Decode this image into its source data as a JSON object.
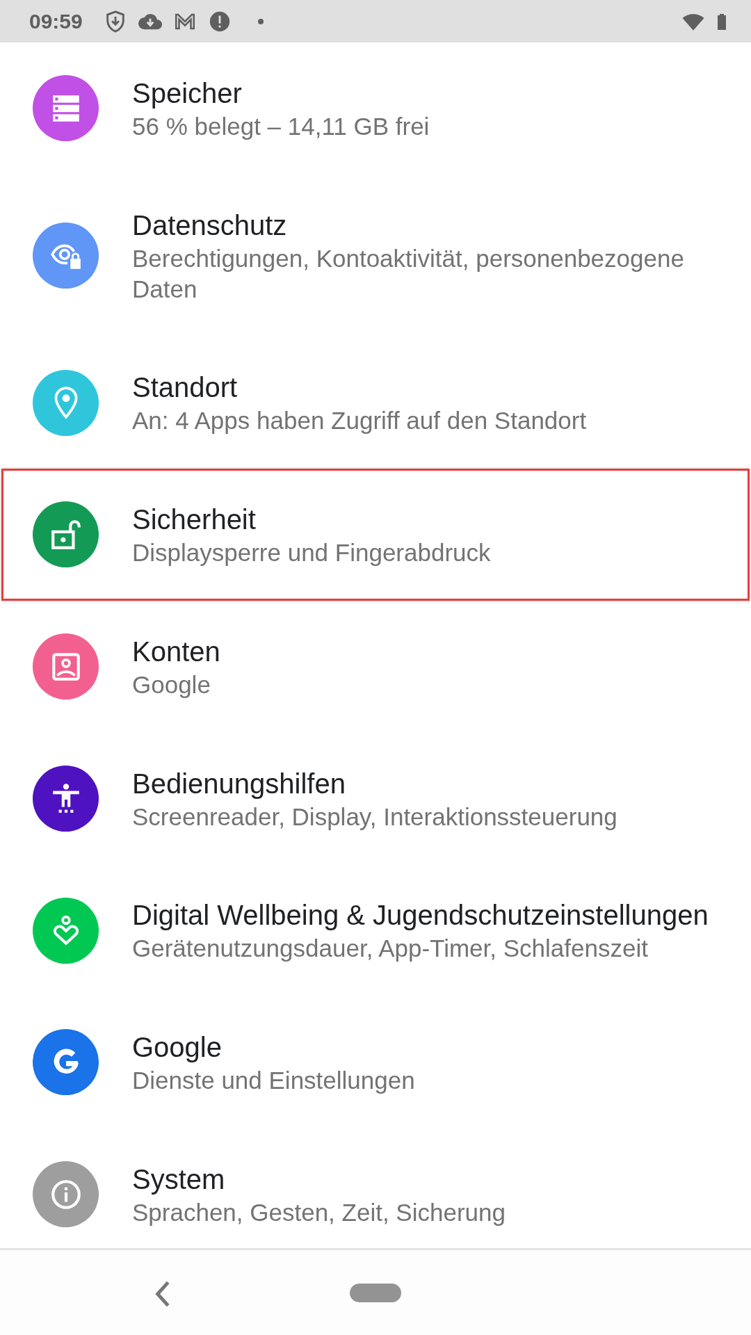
{
  "status_bar": {
    "time": "09:59"
  },
  "items": [
    {
      "title": "Speicher",
      "subtitle": "56 % belegt – 14,11 GB frei",
      "color": "#c150e6",
      "highlighted": false
    },
    {
      "title": "Datenschutz",
      "subtitle": "Berechtigungen, Kontoaktivität, personenbezogene Daten",
      "color": "#6096f5",
      "highlighted": false
    },
    {
      "title": "Standort",
      "subtitle": "An: 4 Apps haben Zugriff auf den Standort",
      "color": "#2fc6dc",
      "highlighted": false
    },
    {
      "title": "Sicherheit",
      "subtitle": "Displaysperre und Fingerabdruck",
      "color": "#139b55",
      "highlighted": true
    },
    {
      "title": "Konten",
      "subtitle": "Google",
      "color": "#f26090",
      "highlighted": false
    },
    {
      "title": "Bedienungshilfen",
      "subtitle": "Screenreader, Display, Interaktionssteuerung",
      "color": "#4e12c0",
      "highlighted": false
    },
    {
      "title": "Digital Wellbeing & Jugendschutzeinstellungen",
      "subtitle": "Gerätenutzungsdauer, App-Timer, Schlafenszeit",
      "color": "#00c853",
      "highlighted": false
    },
    {
      "title": "Google",
      "subtitle": "Dienste und Einstellungen",
      "color": "#1a73e8",
      "highlighted": false
    },
    {
      "title": "System",
      "subtitle": "Sprachen, Gesten, Zeit, Sicherung",
      "color": "#9e9e9e",
      "highlighted": false
    }
  ]
}
